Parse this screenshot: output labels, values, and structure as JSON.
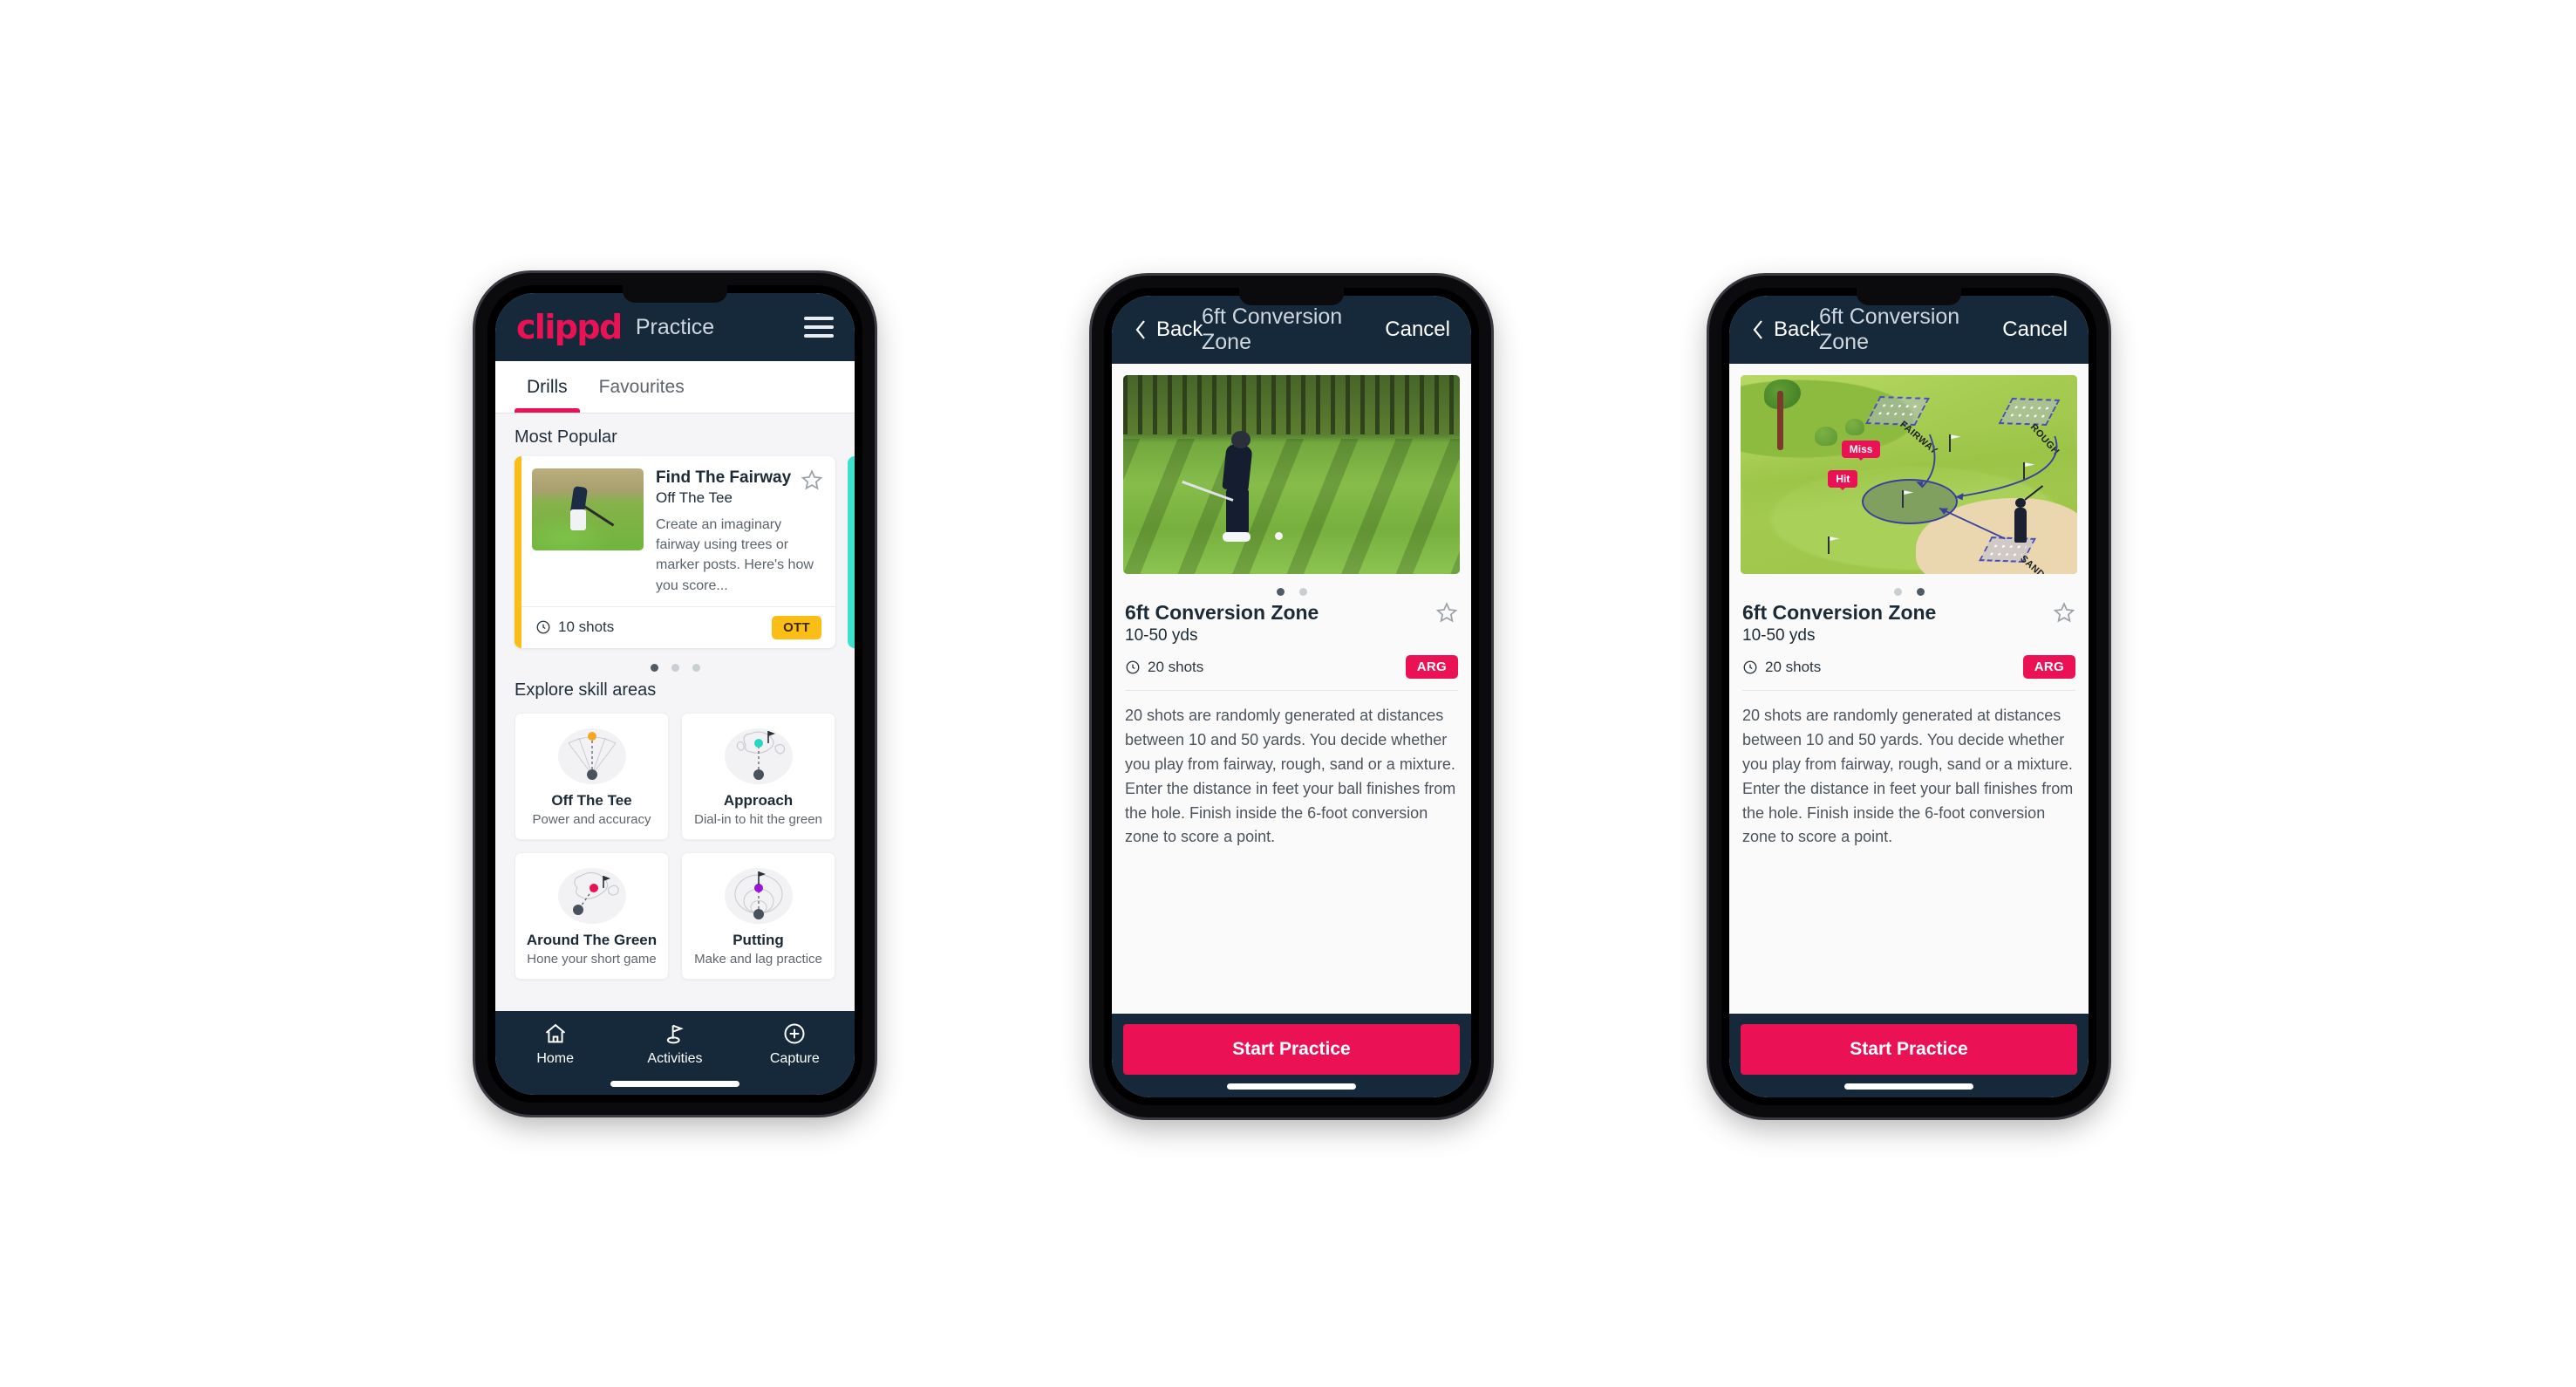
{
  "phones": {
    "practice": {
      "appbar": {
        "logo": "clippd",
        "title": "Practice",
        "menu_icon": "hamburger-menu-icon"
      },
      "tabs": [
        {
          "label": "Drills",
          "active": true
        },
        {
          "label": "Favourites",
          "active": false
        }
      ],
      "sections": {
        "most_popular_title": "Most Popular",
        "explore_title": "Explore skill areas"
      },
      "drill_card": {
        "title": "Find The Fairway",
        "subtitle": "Off The Tee",
        "description": "Create an imaginary fairway using trees or marker posts. Here's how you score...",
        "shots": "10 shots",
        "badge": "OTT",
        "accent_color": "#fbbe17",
        "next_card_accent": "#3ee0cb",
        "favourite_icon": "star-outline-icon",
        "shots_icon": "clock-icon"
      },
      "carousel_dots": {
        "count": 3,
        "active_index": 0
      },
      "skill_areas": [
        {
          "name": "Off The Tee",
          "desc": "Power and accuracy",
          "icon": "tee-fan-icon",
          "dot_color": "#f5a623"
        },
        {
          "name": "Approach",
          "desc": "Dial-in to hit the green",
          "icon": "approach-green-icon",
          "dot_color": "#25d7c0"
        },
        {
          "name": "Around The Green",
          "desc": "Hone your short game",
          "icon": "around-green-icon",
          "dot_color": "#ea1155"
        },
        {
          "name": "Putting",
          "desc": "Make and lag practice",
          "icon": "putting-rings-icon",
          "dot_color": "#9b13d4"
        }
      ],
      "tabbar": [
        {
          "label": "Home",
          "icon": "home-icon",
          "active": false
        },
        {
          "label": "Activities",
          "icon": "golf-flag-icon",
          "active": true
        },
        {
          "label": "Capture",
          "icon": "plus-circle-icon",
          "active": false
        }
      ]
    },
    "detail_video": {
      "appbar": {
        "back_label": "Back",
        "back_icon": "chevron-left-icon",
        "title": "6ft Conversion Zone",
        "cancel_label": "Cancel"
      },
      "media_type": "video-thumbnail-golfer-chipping",
      "carousel_dots": {
        "count": 2,
        "active_index": 0
      },
      "title": "6ft Conversion Zone",
      "subtitle": "10-50 yds",
      "shots": "20 shots",
      "shots_icon": "clock-icon",
      "badge": "ARG",
      "badge_color": "#ea1155",
      "favourite_icon": "star-outline-icon",
      "description": "20 shots are randomly generated at distances between 10 and 50 yards. You decide whether you play from fairway, rough, sand or a mixture. Enter the distance in feet your ball finishes from the hole. Finish inside the 6-foot conversion zone to score a point.",
      "cta_label": "Start Practice"
    },
    "detail_illustration": {
      "appbar": {
        "back_label": "Back",
        "back_icon": "chevron-left-icon",
        "title": "6ft Conversion Zone",
        "cancel_label": "Cancel"
      },
      "media_type": "course-diagram-illustration",
      "illustration_labels": {
        "fairway": "FAIRWAY",
        "rough": "ROUGH",
        "sand": "SAND",
        "miss_pin": "Miss",
        "hit_pin": "Hit"
      },
      "carousel_dots": {
        "count": 2,
        "active_index": 1
      },
      "title": "6ft Conversion Zone",
      "subtitle": "10-50 yds",
      "shots": "20 shots",
      "shots_icon": "clock-icon",
      "badge": "ARG",
      "badge_color": "#ea1155",
      "favourite_icon": "star-outline-icon",
      "description": "20 shots are randomly generated at distances between 10 and 50 yards. You decide whether you play from fairway, rough, sand or a mixture. Enter the distance in feet your ball finishes from the hole. Finish inside the 6-foot conversion zone to score a point.",
      "cta_label": "Start Practice"
    }
  },
  "theme": {
    "dark_navy": "#15293b",
    "pink": "#ea1155",
    "amber": "#fbbe17",
    "teal": "#3ee0cb",
    "page_bg": "#ffffff"
  }
}
